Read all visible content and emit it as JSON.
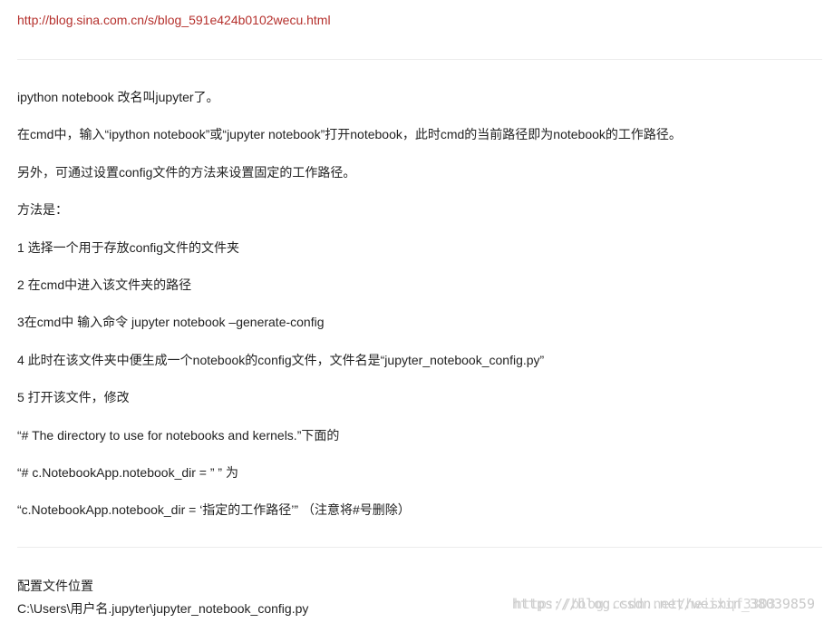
{
  "source_link": "http://blog.sina.com.cn/s/blog_591e424b0102wecu.html",
  "paragraphs": [
    "ipython notebook 改名叫jupyter了。",
    "在cmd中，输入“ipython notebook”或“jupyter notebook”打开notebook，此时cmd的当前路径即为notebook的工作路径。",
    "另外，可通过设置config文件的方法来设置固定的工作路径。",
    "方法是：",
    "1 选择一个用于存放config文件的文件夹",
    "2 在cmd中进入该文件夹的路径",
    "3在cmd中 输入命令 jupyter notebook –generate-config",
    "4 此时在该文件夹中便生成一个notebook的config文件，文件名是“jupyter_notebook_config.py”",
    "5 打开该文件，修改",
    " “# The directory to use for notebooks and kernels.”下面的",
    " “# c.NotebookApp.notebook_dir = ” ” 为",
    " “c.NotebookApp.notebook_dir = ‘指定的工作路径’” （注意将#号删除）"
  ],
  "config_location": {
    "heading": "配置文件位置",
    "path": "C:\\Users\\用户名.jupyter\\jupyter_notebook_config.py"
  },
  "watermark": {
    "text_a": "https://blog.csdn.net/weixin_38039859",
    "text_b": "http://blog.csdn.net/heishqf3303"
  }
}
